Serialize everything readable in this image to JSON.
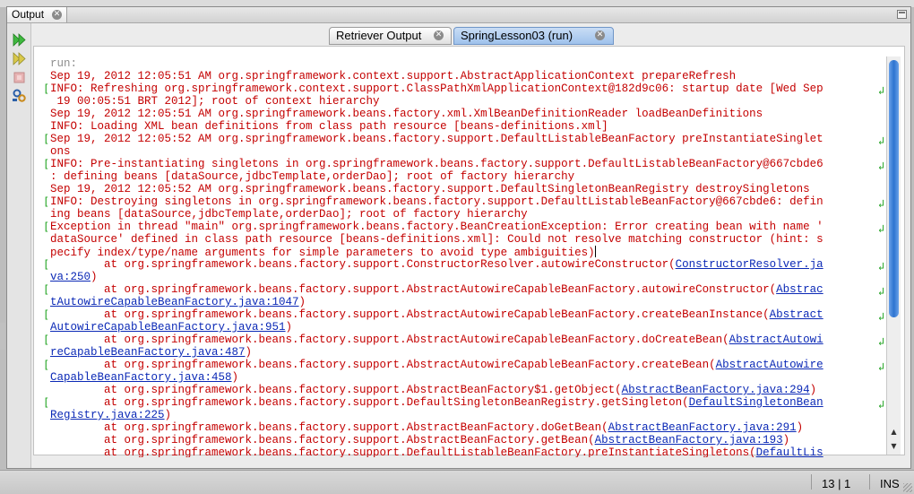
{
  "panel": {
    "tab_label": "Output",
    "close_glyph": "⊗"
  },
  "inner_tabs": [
    {
      "label": "Retriever Output",
      "active": false
    },
    {
      "label": "SpringLesson03 (run)",
      "active": true
    }
  ],
  "toolbar": {
    "icons": [
      "rerun-icon",
      "rerun-with-options-icon",
      "stop-icon",
      "output-settings-icon"
    ]
  },
  "console": {
    "lines": [
      {
        "text": "run:",
        "style": "gray"
      },
      {
        "text": "Sep 19, 2012 12:05:51 AM org.springframework.context.support.AbstractApplicationContext prepareRefresh"
      },
      {
        "text": "INFO: Refreshing org.springframework.context.support.ClassPathXmlApplicationContext@182d9c06: startup date [Wed Sep"
      },
      {
        "text": " 19 00:05:51 BRT 2012]; root of context hierarchy"
      },
      {
        "text": "Sep 19, 2012 12:05:51 AM org.springframework.beans.factory.xml.XmlBeanDefinitionReader loadBeanDefinitions"
      },
      {
        "text": "INFO: Loading XML bean definitions from class path resource [beans-definitions.xml]"
      },
      {
        "text": "Sep 19, 2012 12:05:52 AM org.springframework.beans.factory.support.DefaultListableBeanFactory preInstantiateSinglet"
      },
      {
        "text": "ons"
      },
      {
        "text": "INFO: Pre-instantiating singletons in org.springframework.beans.factory.support.DefaultListableBeanFactory@667cbde6"
      },
      {
        "text": ": defining beans [dataSource,jdbcTemplate,orderDao]; root of factory hierarchy"
      },
      {
        "text": "Sep 19, 2012 12:05:52 AM org.springframework.beans.factory.support.DefaultSingletonBeanRegistry destroySingletons"
      },
      {
        "text": "INFO: Destroying singletons in org.springframework.beans.factory.support.DefaultListableBeanFactory@667cbde6: defin"
      },
      {
        "text": "ing beans [dataSource,jdbcTemplate,orderDao]; root of factory hierarchy"
      },
      {
        "text": "Exception in thread \"main\" org.springframework.beans.factory.BeanCreationException: Error creating bean with name '"
      },
      {
        "text": "dataSource' defined in class path resource [beans-definitions.xml]: Could not resolve matching constructor (hint: s"
      },
      {
        "text": "pecify index/type/name arguments for simple parameters to avoid type ambiguities)",
        "cursor": true
      },
      {
        "text": "        at org.springframework.beans.factory.support.ConstructorResolver.autowireConstructor(",
        "link": "ConstructorResolver.ja"
      },
      {
        "text": "",
        "link": "va:250",
        "tail": ")"
      },
      {
        "text": "        at org.springframework.beans.factory.support.AbstractAutowireCapableBeanFactory.autowireConstructor(",
        "link": "Abstrac"
      },
      {
        "text": "",
        "link": "tAutowireCapableBeanFactory.java:1047",
        "tail": ")"
      },
      {
        "text": "        at org.springframework.beans.factory.support.AbstractAutowireCapableBeanFactory.createBeanInstance(",
        "link": "Abstract"
      },
      {
        "text": "",
        "link": "AutowireCapableBeanFactory.java:951",
        "tail": ")"
      },
      {
        "text": "        at org.springframework.beans.factory.support.AbstractAutowireCapableBeanFactory.doCreateBean(",
        "link": "AbstractAutowi"
      },
      {
        "text": "",
        "link": "reCapableBeanFactory.java:487",
        "tail": ")"
      },
      {
        "text": "        at org.springframework.beans.factory.support.AbstractAutowireCapableBeanFactory.createBean(",
        "link": "AbstractAutowire"
      },
      {
        "text": "",
        "link": "CapableBeanFactory.java:458",
        "tail": ")"
      },
      {
        "text": "        at org.springframework.beans.factory.support.AbstractBeanFactory$1.getObject(",
        "link": "AbstractBeanFactory.java:294",
        "tail": ")"
      },
      {
        "text": "        at org.springframework.beans.factory.support.DefaultSingletonBeanRegistry.getSingleton(",
        "link": "DefaultSingletonBean"
      },
      {
        "text": "",
        "link": "Registry.java:225",
        "tail": ")"
      },
      {
        "text": "        at org.springframework.beans.factory.support.AbstractBeanFactory.doGetBean(",
        "link": "AbstractBeanFactory.java:291",
        "tail": ")"
      },
      {
        "text": "        at org.springframework.beans.factory.support.AbstractBeanFactory.getBean(",
        "link": "AbstractBeanFactory.java:193",
        "tail": ")"
      },
      {
        "text": "        at org.springframework.beans.factory.support.DefaultListableBeanFactory.preInstantiateSingletons(",
        "link": "DefaultLis"
      }
    ]
  },
  "status": {
    "position": "13 | 1",
    "mode": "INS"
  },
  "colors": {
    "error_text": "#c40000",
    "link": "#0b29b6",
    "run_text": "#8f8f8f",
    "fold_marker": "#21a321",
    "scroll_thumb": "#2d73d0"
  }
}
